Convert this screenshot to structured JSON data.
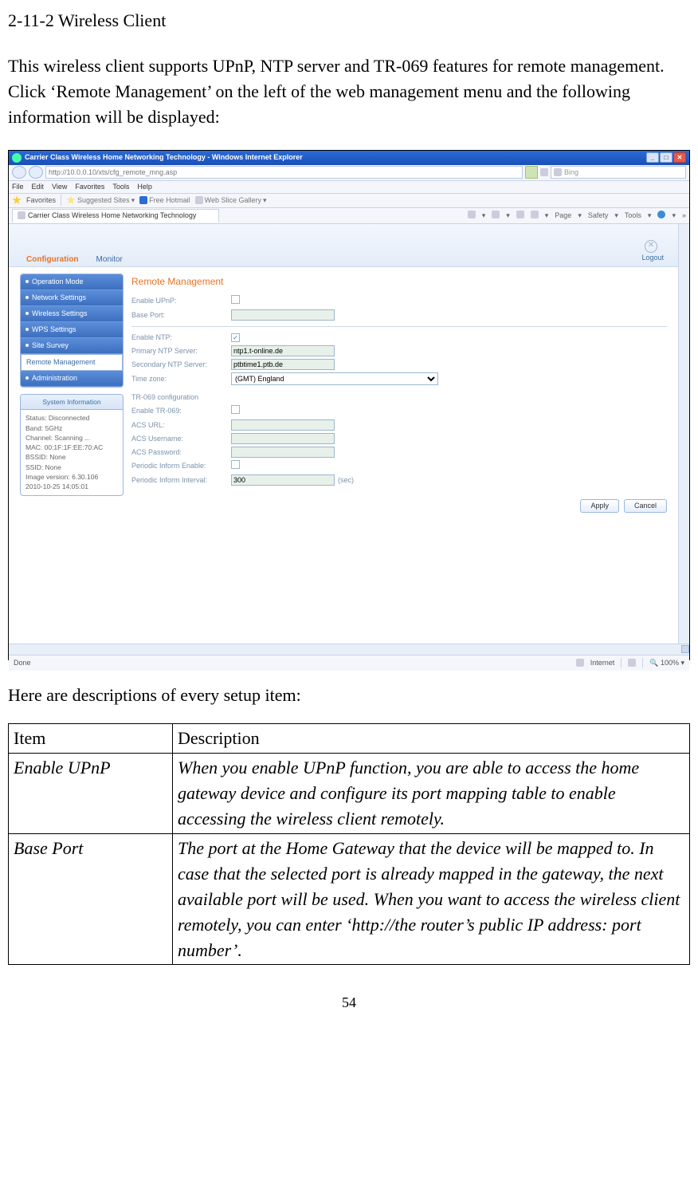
{
  "section_heading": "2-11-2 Wireless Client",
  "intro": "This wireless client supports UPnP, NTP server and TR-069 features for remote management. Click ‘Remote Management’ on the left of the web management menu and the following information will be displayed:",
  "ie": {
    "title": "Carrier Class Wireless Home Networking Technology - Windows Internet Explorer",
    "address": "http://10.0.0.10/xts/cfg_remote_mng.asp",
    "search_placeholder": "Bing",
    "menu": {
      "file": "File",
      "edit": "Edit",
      "view": "View",
      "favorites": "Favorites",
      "tools": "Tools",
      "help": "Help"
    },
    "favorites": {
      "label": "Favorites",
      "sugg": "Suggested Sites",
      "hotmail": "Free Hotmail",
      "gallery": "Web Slice Gallery"
    },
    "tab": "Carrier Class Wireless Home Networking Technology",
    "toolbar": {
      "page": "Page",
      "safety": "Safety",
      "tools": "Tools"
    },
    "status": {
      "done": "Done",
      "internet": "Internet",
      "zoom": "100%"
    }
  },
  "page": {
    "tabs": {
      "config": "Configuration",
      "monitor": "Monitor",
      "logout": "Logout"
    },
    "nav": {
      "op": "Operation Mode",
      "net": "Network Settings",
      "wl": "Wireless Settings",
      "wps": "WPS Settings",
      "survey": "Site Survey",
      "remote": "Remote Management",
      "admin": "Administration"
    },
    "sysinfo": {
      "header": "System Information",
      "status": "Status: Disconnected",
      "band": "Band: 5GHz",
      "channel": "Channel: Scanning ...",
      "mac": "MAC: 00:1F:1F:EE:70:AC",
      "bssid": "BSSID: None",
      "ssid": "SSID: None",
      "image": "Image version: 6.30.106",
      "datetime": "2010-10-25 14:05:01"
    },
    "content": {
      "heading": "Remote Management",
      "labels": {
        "upnp": "Enable UPnP:",
        "baseport": "Base Port:",
        "ntp": "Enable NTP:",
        "ntp1": "Primary NTP Server:",
        "ntp2": "Secondary NTP Server:",
        "tz": "Time zone:",
        "tr069_section": "TR-069 configuration",
        "tr069": "Enable TR-069:",
        "acs_url": "ACS URL:",
        "acs_user": "ACS Username:",
        "acs_pass": "ACS Password:",
        "inform_en": "Periodic Inform Enable:",
        "inform_int": "Periodic Inform Interval:",
        "sec": "(sec)"
      },
      "values": {
        "ntp1": "ntp1.t-online.de",
        "ntp2": "ptbtime1.ptb.de",
        "tz": "(GMT) England",
        "interval": "300"
      },
      "buttons": {
        "apply": "Apply",
        "cancel": "Cancel"
      }
    }
  },
  "desc_intro": "Here are descriptions of every setup item:",
  "table": {
    "headers": {
      "item": "Item",
      "desc": "Description"
    },
    "rows": [
      {
        "item": "Enable UPnP",
        "desc": "When you enable UPnP function, you are able to access the home gateway device and configure its port mapping table to enable accessing the wireless client remotely."
      },
      {
        "item": "Base Port",
        "desc": "The port at the Home Gateway that the device will be mapped to. In case that the selected port is already mapped in the gateway, the next available port will be used. When you want to access the wireless client remotely, you can enter ‘http://the router’s public IP address: port number’."
      }
    ]
  },
  "page_num": "54"
}
